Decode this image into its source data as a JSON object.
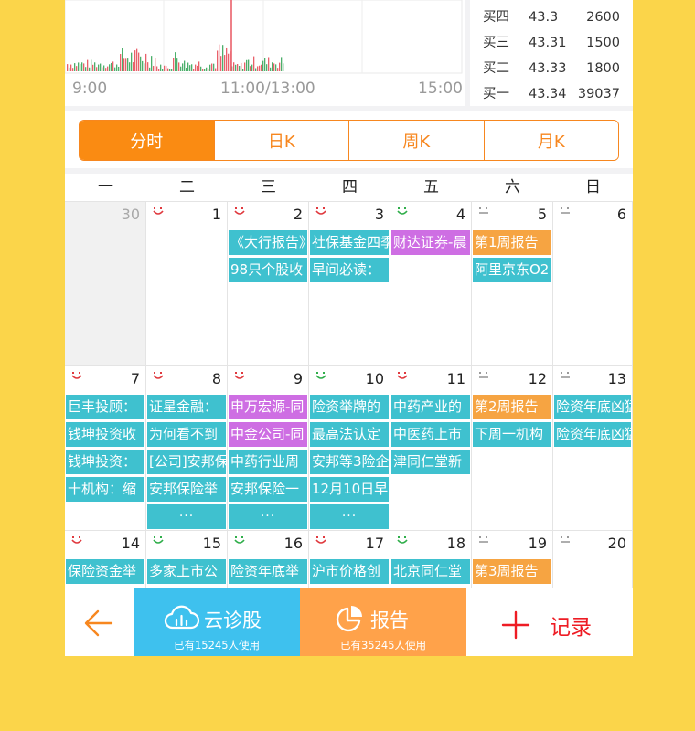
{
  "chart": {
    "time_labels": [
      "9:00",
      "11:00/13:00",
      "15:00"
    ]
  },
  "quote": {
    "rows": [
      {
        "label": "买四",
        "price": "43.3",
        "volume": "2600"
      },
      {
        "label": "买三",
        "price": "43.31",
        "volume": "1500"
      },
      {
        "label": "买二",
        "price": "43.33",
        "volume": "1800"
      },
      {
        "label": "买一",
        "price": "43.34",
        "volume": "39037"
      }
    ]
  },
  "period_tabs": [
    {
      "label": "分时",
      "active": true
    },
    {
      "label": "日K",
      "active": false
    },
    {
      "label": "周K",
      "active": false
    },
    {
      "label": "月K",
      "active": false
    }
  ],
  "calendar": {
    "weekdays": [
      "一",
      "二",
      "三",
      "四",
      "五",
      "六",
      "日"
    ],
    "weeks": [
      [
        {
          "day": "30",
          "grey": true,
          "mood": "",
          "events": []
        },
        {
          "day": "1",
          "mood": "red",
          "events": []
        },
        {
          "day": "2",
          "mood": "red",
          "events": [
            {
              "text": "《大行报告》",
              "color": "teal"
            },
            {
              "text": "98只个股收",
              "color": "teal"
            }
          ]
        },
        {
          "day": "3",
          "mood": "red",
          "events": [
            {
              "text": "社保基金四季",
              "color": "teal"
            },
            {
              "text": "早间必读：",
              "color": "teal"
            }
          ]
        },
        {
          "day": "4",
          "mood": "green",
          "events": [
            {
              "text": "财达证券-晨",
              "color": "pink"
            }
          ]
        },
        {
          "day": "5",
          "mood": "grey",
          "events": [
            {
              "text": "第1周报告",
              "color": "orange"
            },
            {
              "text": "阿里京东O2",
              "color": "teal"
            }
          ]
        },
        {
          "day": "6",
          "mood": "grey",
          "events": []
        }
      ],
      [
        {
          "day": "7",
          "mood": "red",
          "events": [
            {
              "text": "巨丰投顾：",
              "color": "teal"
            },
            {
              "text": "钱坤投资收",
              "color": "teal"
            },
            {
              "text": "钱坤投资：",
              "color": "teal"
            },
            {
              "text": "十机构：缩",
              "color": "teal"
            }
          ]
        },
        {
          "day": "8",
          "mood": "red",
          "events": [
            {
              "text": "证星金融：",
              "color": "teal"
            },
            {
              "text": "为何看不到",
              "color": "teal"
            },
            {
              "text": "[公司]安邦保",
              "color": "teal"
            },
            {
              "text": "安邦保险举",
              "color": "teal"
            },
            {
              "text": "···",
              "color": "more"
            }
          ]
        },
        {
          "day": "9",
          "mood": "red",
          "events": [
            {
              "text": "申万宏源-同",
              "color": "pink"
            },
            {
              "text": "中金公司-同",
              "color": "pink"
            },
            {
              "text": "中药行业周",
              "color": "teal"
            },
            {
              "text": "安邦保险一",
              "color": "teal"
            },
            {
              "text": "···",
              "color": "more"
            }
          ]
        },
        {
          "day": "10",
          "mood": "green",
          "events": [
            {
              "text": "险资举牌的",
              "color": "teal"
            },
            {
              "text": "最高法认定",
              "color": "teal"
            },
            {
              "text": "安邦等3险企",
              "color": "teal"
            },
            {
              "text": "12月10日早",
              "color": "teal"
            },
            {
              "text": "···",
              "color": "more"
            }
          ]
        },
        {
          "day": "11",
          "mood": "red",
          "events": [
            {
              "text": "中药产业的",
              "color": "teal"
            },
            {
              "text": "中医药上市",
              "color": "teal"
            },
            {
              "text": "津同仁堂新",
              "color": "teal"
            }
          ]
        },
        {
          "day": "12",
          "mood": "grey",
          "events": [
            {
              "text": "第2周报告",
              "color": "orange"
            },
            {
              "text": "下周一机构",
              "color": "teal"
            }
          ]
        },
        {
          "day": "13",
          "mood": "grey",
          "events": [
            {
              "text": "险资年底凶猛",
              "color": "teal"
            },
            {
              "text": "险资年底凶猛",
              "color": "teal"
            }
          ]
        }
      ],
      [
        {
          "day": "14",
          "mood": "red",
          "events": [
            {
              "text": "保险资金举",
              "color": "teal"
            }
          ]
        },
        {
          "day": "15",
          "mood": "green",
          "events": [
            {
              "text": "多家上市公",
              "color": "teal"
            }
          ]
        },
        {
          "day": "16",
          "mood": "green",
          "events": [
            {
              "text": "险资年底举",
              "color": "teal"
            }
          ]
        },
        {
          "day": "17",
          "mood": "red",
          "events": [
            {
              "text": "沪市价格创",
              "color": "teal"
            }
          ]
        },
        {
          "day": "18",
          "mood": "green",
          "events": [
            {
              "text": "北京同仁堂",
              "color": "teal"
            }
          ]
        },
        {
          "day": "19",
          "mood": "grey",
          "events": [
            {
              "text": "第3周报告",
              "color": "orange"
            }
          ]
        },
        {
          "day": "20",
          "mood": "grey",
          "events": []
        }
      ]
    ]
  },
  "bottom_bar": {
    "cloud_label": "云诊股",
    "cloud_sub": "已有15245人使用",
    "report_label": "报告",
    "report_sub": "已有35245人使用",
    "record_label": "记录"
  },
  "colors": {
    "accent_orange": "#fa8b12",
    "teal_event": "#3fc1cf",
    "pink_event": "#ce6ee3",
    "orange_event": "#f6a442",
    "cloud_blue": "#3ec1ee",
    "record_red": "#ee1c24",
    "mood_red": "#e0393e",
    "mood_green": "#2fae4a",
    "mood_grey": "#9a9a9a"
  }
}
